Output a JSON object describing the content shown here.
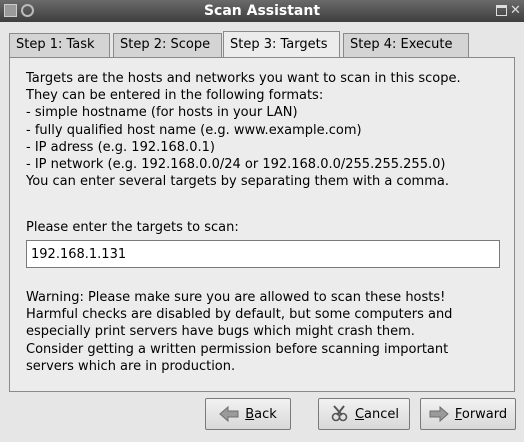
{
  "window": {
    "title": "Scan Assistant"
  },
  "tabs": [
    {
      "label": "Step 1: Task",
      "active": false
    },
    {
      "label": "Step 2: Scope",
      "active": false
    },
    {
      "label": "Step 3: Targets",
      "active": true
    },
    {
      "label": "Step 4: Execute",
      "active": false
    }
  ],
  "description": [
    "Targets are the hosts and networks you want to scan in this scope.",
    "They can be entered in the following formats:",
    " - simple hostname (for hosts in your LAN)",
    " - fully qualified host name (e.g. www.example.com)",
    " - IP adress (e.g. 192.168.0.1)",
    " - IP network (e.g. 192.168.0.0/24 or 192.168.0.0/255.255.255.0)",
    "You can enter several targets by separating them with a comma."
  ],
  "targets": {
    "label": "Please enter the targets to scan:",
    "value": "192.168.1.131"
  },
  "warning": [
    "Warning: Please make sure you are allowed to scan these hosts!",
    "Harmful checks are disabled by default, but some computers and",
    "especially print servers have bugs which might crash them.",
    "Consider getting a written permission before scanning important",
    "servers which are in production."
  ],
  "buttons": {
    "back": {
      "mnemonic": "B",
      "rest": "ack",
      "icon": "arrow-left-icon"
    },
    "cancel": {
      "mnemonic": "C",
      "rest": "ancel",
      "icon": "cancel-icon"
    },
    "forward": {
      "mnemonic": "F",
      "rest": "orward",
      "icon": "arrow-right-icon"
    }
  }
}
